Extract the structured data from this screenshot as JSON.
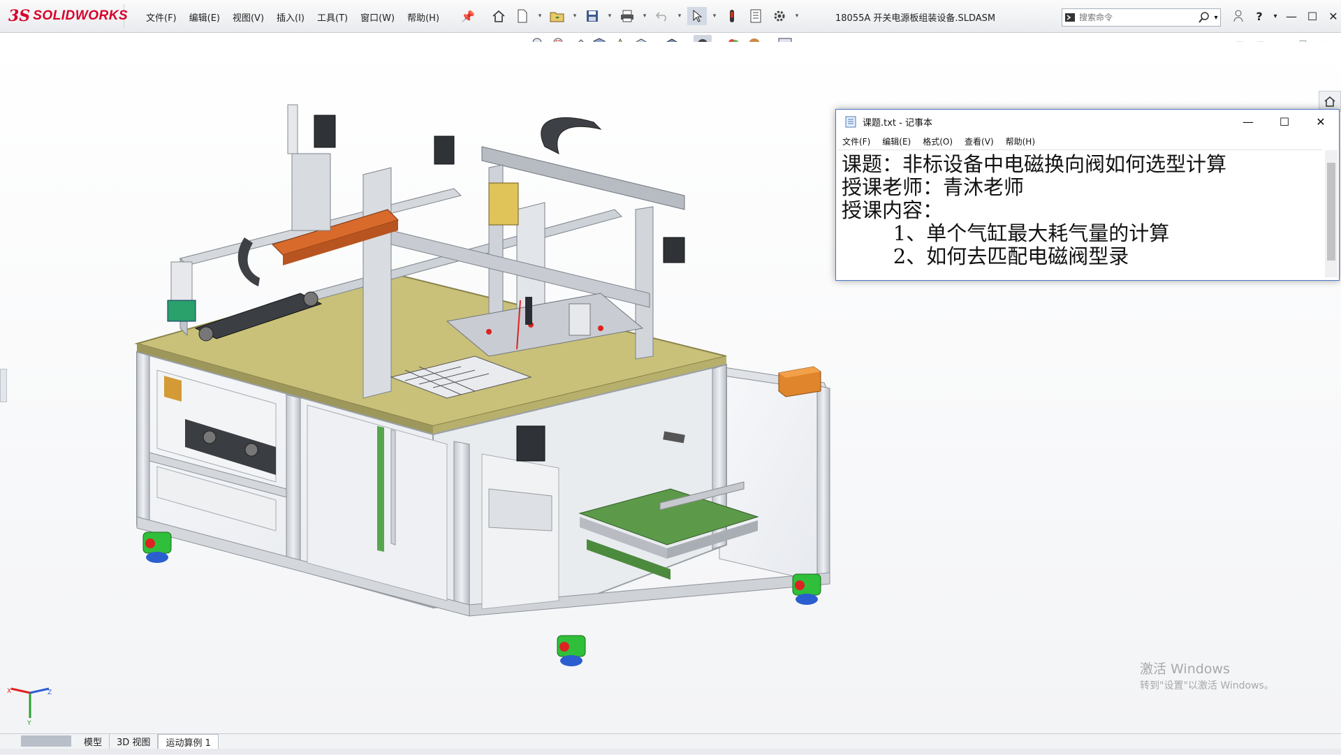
{
  "app": {
    "logo_text": "SOLIDWORKS",
    "document_title": "18055A 开关电源板组装设备.SLDASM"
  },
  "menu": {
    "items": [
      "文件(F)",
      "编辑(E)",
      "视图(V)",
      "插入(I)",
      "工具(T)",
      "窗口(W)",
      "帮助(H)"
    ]
  },
  "search": {
    "placeholder": "搜索命令"
  },
  "notepad": {
    "title": "课题.txt - 记事本",
    "menu": [
      "文件(F)",
      "编辑(E)",
      "格式(O)",
      "查看(V)",
      "帮助(H)"
    ],
    "lines": [
      "课题：非标设备中电磁换向阀如何选型计算",
      "授课老师：青沐老师",
      "授课内容：",
      "        1、单个气缸最大耗气量的计算",
      "        2、如何去匹配电磁阀型录"
    ]
  },
  "watermark": {
    "line1": "激活 Windows",
    "line2": "转到\"设置\"以激活 Windows。"
  },
  "bottom_tabs": [
    "模型",
    "3D 视图",
    "运动算例 1"
  ],
  "colors": {
    "brand": "#d6002a",
    "frame": "#d9dde2",
    "tabletop": "#c9c07a",
    "caster_green": "#2fbf3a",
    "orange_beam": "#d86a2c"
  },
  "icons": [
    "home-icon",
    "new-doc-icon",
    "open-icon",
    "save-icon",
    "print-icon",
    "undo-icon",
    "select-icon",
    "rebuild-icon",
    "file-props-icon",
    "options-icon"
  ]
}
